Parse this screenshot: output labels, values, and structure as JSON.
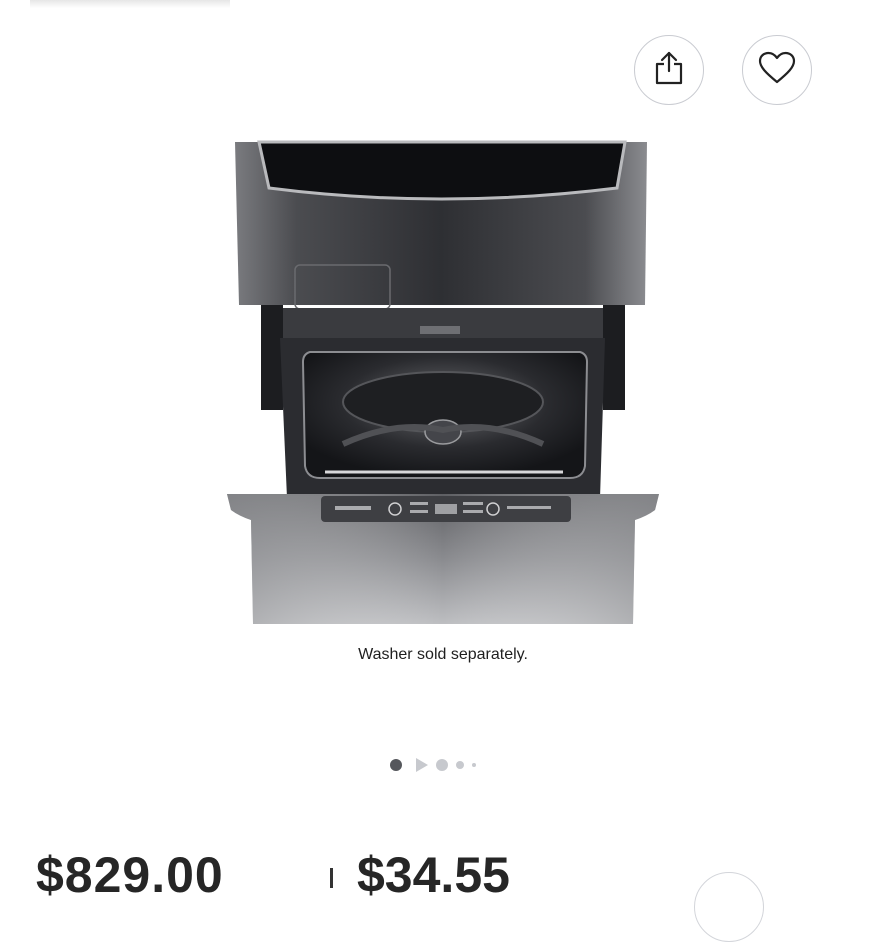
{
  "header": {
    "share_icon": "share-icon",
    "favorite_icon": "heart-icon"
  },
  "product": {
    "image_caption": "Washer sold separately.",
    "image_subject": "pedestal washer drawer"
  },
  "carousel": {
    "dots": [
      "active",
      "video",
      "inactive",
      "inactive-small",
      "inactive-tiny"
    ]
  },
  "pricing": {
    "price": "$829.00",
    "monthly": "$34.55"
  },
  "colors": {
    "icon": "#222222",
    "border": "#c9cbd1",
    "active_dot": "#55575c"
  }
}
